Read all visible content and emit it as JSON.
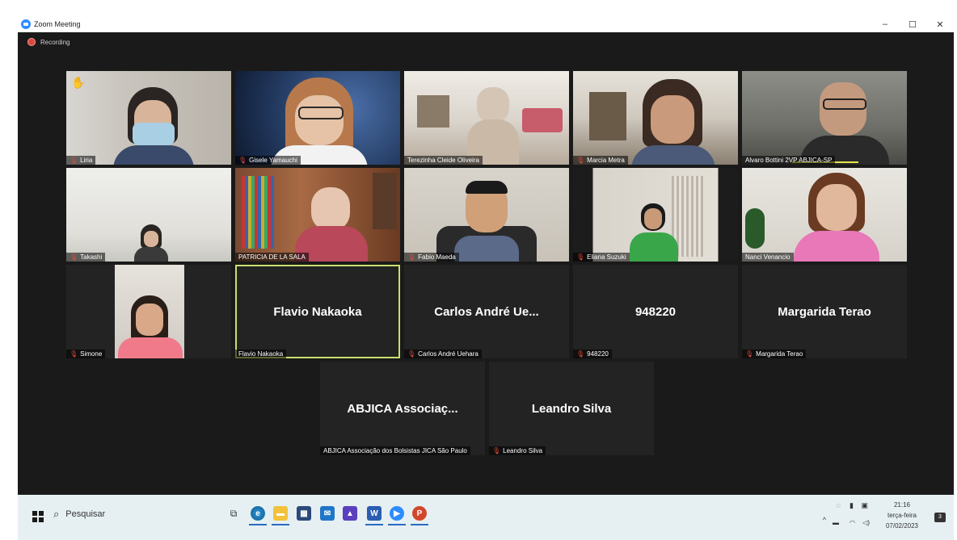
{
  "window": {
    "title": "Zoom Meeting",
    "controls": [
      "–",
      "☐",
      "✕"
    ]
  },
  "recording": {
    "label": "Recording",
    "color": "#e0443e"
  },
  "participants": {
    "row1": [
      {
        "name": "Liria",
        "muted": true
      },
      {
        "name": "Gisele Yamauchi",
        "muted": true
      },
      {
        "name": "Terezinha Cleide Oliveira",
        "muted": false
      },
      {
        "name": "Marcia Metra",
        "muted": true
      },
      {
        "name": "Alvaro Bottini 2VP ABJICA-SP",
        "muted": false
      }
    ],
    "row2": [
      {
        "name": "Takashi",
        "muted": true
      },
      {
        "name": "PATRICIA DE LA SALA",
        "muted": false
      },
      {
        "name": "Fabio Maeda",
        "muted": true
      },
      {
        "name": "Eliana Suzuki",
        "muted": true
      },
      {
        "name": "Nanci Venancio",
        "muted": false
      }
    ],
    "row3": [
      {
        "name": "Simone",
        "muted": true,
        "display": ""
      },
      {
        "name": "Flavio Nakaoka",
        "muted": false,
        "display": "Flavio Nakaoka",
        "active": true
      },
      {
        "name": "Carlos André Uehara",
        "muted": true,
        "display": "Carlos André Ue..."
      },
      {
        "name": "948220",
        "muted": true,
        "display": "948220"
      },
      {
        "name": "Margarida Terao",
        "muted": true,
        "display": "Margarida Terao"
      }
    ],
    "row4": [
      {
        "name": "ABJICA Associação dos Bolsistas JICA São Paulo",
        "muted": false,
        "display": "ABJICA Associaç..."
      },
      {
        "name": "Leandro Silva",
        "muted": true,
        "display": "Leandro Silva"
      }
    ]
  },
  "taskbar": {
    "search_placeholder": "Pesquisar",
    "apps": [
      "task-view",
      "edge",
      "file-explorer",
      "store",
      "mail",
      "photos",
      "word",
      "zoom",
      "powerpoint"
    ],
    "time": "21:16",
    "day": "terça-feira",
    "date": "07/02/2023",
    "notifications": "3"
  }
}
